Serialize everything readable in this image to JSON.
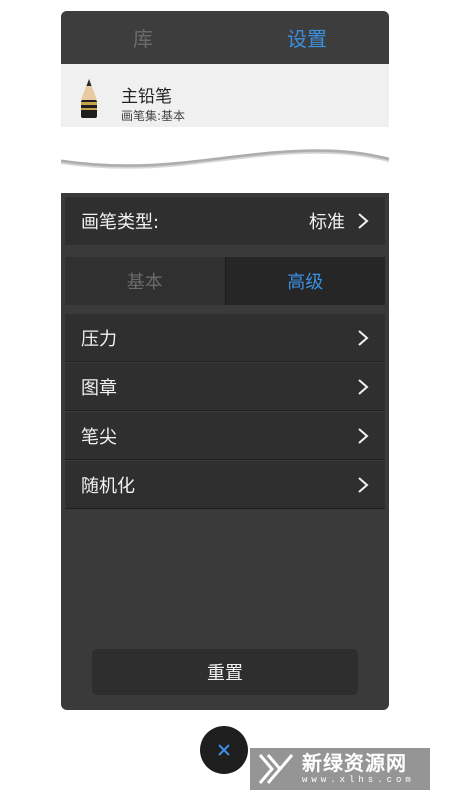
{
  "top_tabs": [
    {
      "label": "库",
      "active": false
    },
    {
      "label": "设置",
      "active": true
    }
  ],
  "brush": {
    "name": "主铅笔",
    "set": "画笔集:基本",
    "icon": "pencil-icon"
  },
  "brush_type": {
    "label": "画笔类型:",
    "value": "标准"
  },
  "segment": {
    "basic": "基本",
    "advanced": "高级",
    "selected": "高级"
  },
  "settings_list": [
    {
      "label": "压力"
    },
    {
      "label": "图章"
    },
    {
      "label": "笔尖"
    },
    {
      "label": "随机化"
    }
  ],
  "reset_label": "重置",
  "close_icon": "close-icon",
  "watermark": {
    "main": "新绿资源网",
    "sub": "www.xlhs.com"
  },
  "colors": {
    "accent": "#3a8fe0",
    "panel": "#3a3a3a",
    "row": "#2f2f2f"
  }
}
